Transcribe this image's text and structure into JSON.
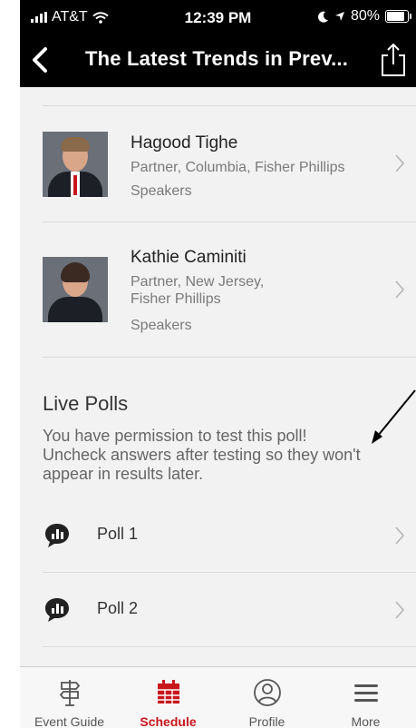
{
  "status_bar": {
    "carrier": "AT&T",
    "time": "12:39 PM",
    "battery": "80%"
  },
  "nav": {
    "title": "The Latest Trends in Prev..."
  },
  "speakers": [
    {
      "name": "Hagood Tighe",
      "role_lines": [
        "Partner, Columbia, Fisher Phillips"
      ],
      "category": "Speakers"
    },
    {
      "name": "Kathie Caminiti",
      "role_lines": [
        "Partner, New Jersey,",
        "Fisher Phillips"
      ],
      "category": "Speakers"
    }
  ],
  "live_polls": {
    "heading": "Live Polls",
    "description": "You have permission to test this poll! Uncheck answers after testing so they won't appear in results later.",
    "polls": [
      {
        "label": "Poll 1"
      },
      {
        "label": "Poll 2"
      }
    ]
  },
  "tabs": [
    {
      "label": "Event Guide",
      "icon": "signpost-icon",
      "active": false
    },
    {
      "label": "Schedule",
      "icon": "calendar-icon",
      "active": true
    },
    {
      "label": "Profile",
      "icon": "profile-icon",
      "active": false
    },
    {
      "label": "More",
      "icon": "menu-icon",
      "active": false
    }
  ],
  "colors": {
    "accent": "#c8161d",
    "header_bg": "#000000",
    "page_bg": "#f2f2f2"
  }
}
